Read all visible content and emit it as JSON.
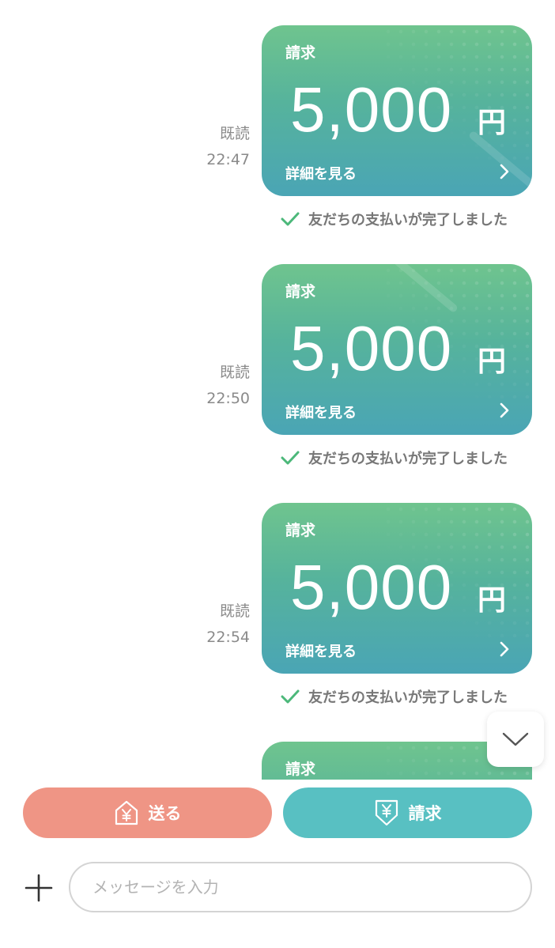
{
  "messages": [
    {
      "read_label": "既読",
      "time": "22:47",
      "card_type": "請求",
      "amount": "5,000",
      "currency": "円",
      "details_label": "詳細を見る",
      "status": "友だちの支払いが完了しました"
    },
    {
      "read_label": "既読",
      "time": "22:50",
      "card_type": "請求",
      "amount": "5,000",
      "currency": "円",
      "details_label": "詳細を見る",
      "status": "友だちの支払いが完了しました"
    },
    {
      "read_label": "既読",
      "time": "22:54",
      "card_type": "請求",
      "amount": "5,000",
      "currency": "円",
      "details_label": "詳細を見る",
      "status": "友だちの支払いが完了しました"
    },
    {
      "card_type": "請求"
    }
  ],
  "actions": {
    "send_label": "送る",
    "request_label": "請求"
  },
  "composer": {
    "placeholder": "メッセージを入力"
  },
  "colors": {
    "send": "#ef9585",
    "request": "#58c0c2",
    "check": "#4cb87a",
    "card_top": "#6fc48e",
    "card_bottom": "#4aa5b5"
  },
  "icons": {
    "scroll": "chevron-down-icon",
    "send": "house-yen-icon",
    "request": "arrow-yen-icon",
    "add": "plus-icon",
    "status": "checkmark-icon",
    "card": "chevron-right-icon"
  }
}
